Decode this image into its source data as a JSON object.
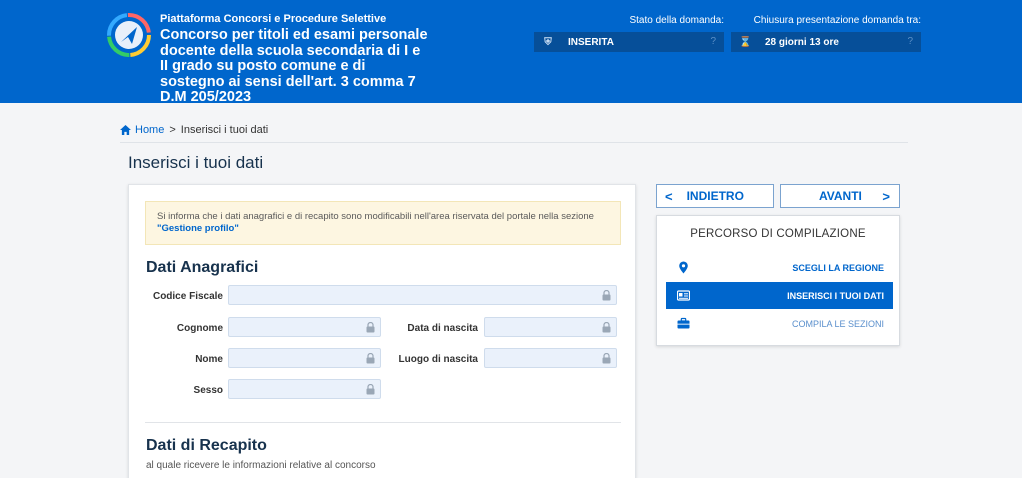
{
  "header": {
    "subtitle": "Piattaforma Concorsi e Procedure Selettive",
    "title": "Concorso per titoli ed esami personale docente della scuola secondaria di I e II grado su posto comune e di sostegno ai sensi dell'art. 3 comma 7 D.M 205/2023",
    "status_label": "Stato della domanda:",
    "status_value": "INSERITA",
    "deadline_label": "Chiusura presentazione domanda tra:",
    "deadline_value": "28 giorni 13 ore",
    "help_glyph": "?"
  },
  "breadcrumb": {
    "home": "Home",
    "separator": ">",
    "current": "Inserisci i tuoi dati"
  },
  "page_title": "Inserisci i tuoi dati",
  "notice": {
    "text": "Si informa che i dati anagrafici e di recapito sono modificabili nell'area riservata del portale nella sezione",
    "link": "\"Gestione profilo\""
  },
  "anagrafici": {
    "title": "Dati Anagrafici",
    "codice_fiscale_label": "Codice Fiscale",
    "codice_fiscale_value": "",
    "cognome_label": "Cognome",
    "cognome_value": "",
    "nome_label": "Nome",
    "nome_value": "",
    "sesso_label": "Sesso",
    "sesso_value": "",
    "data_nascita_label": "Data di nascita",
    "data_nascita_value": "",
    "luogo_nascita_label": "Luogo di nascita",
    "luogo_nascita_value": ""
  },
  "recapito": {
    "title": "Dati di Recapito",
    "subtitle": "al quale ricevere le informazioni relative al concorso"
  },
  "nav": {
    "back_label": "INDIETRO",
    "next_label": "AVANTI",
    "back_chevron": "<",
    "next_chevron": ">"
  },
  "percorso": {
    "title": "PERCORSO DI COMPILAZIONE",
    "items": [
      {
        "label": "SCEGLI LA REGIONE",
        "icon": "map-pin-icon"
      },
      {
        "label": "INSERISCI I TUOI DATI",
        "icon": "id-card-icon"
      },
      {
        "label": "COMPILA LE SEZIONI",
        "icon": "briefcase-icon"
      }
    ]
  },
  "colors": {
    "brand_blue": "#0066cc",
    "header_box": "#064f99",
    "notice_bg": "#fdf6e1",
    "field_bg": "#eaf1fb"
  }
}
